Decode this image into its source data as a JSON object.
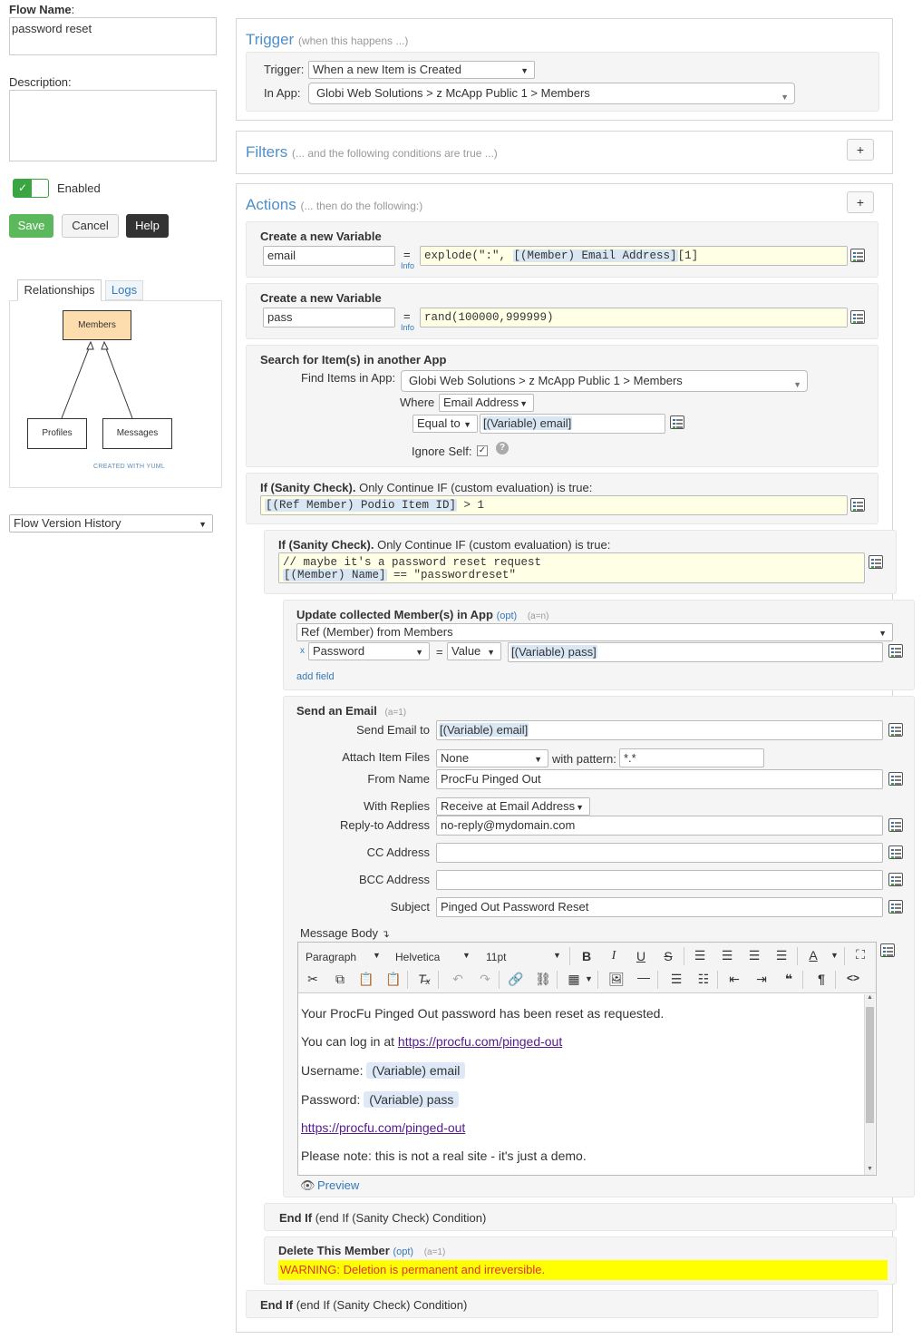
{
  "left": {
    "flow_name_label": "Flow Name",
    "flow_name_colon": ":",
    "flow_name_value": "password reset",
    "description_label": "Description:",
    "description_value": "",
    "enabled_label": "Enabled",
    "buttons": {
      "save": "Save",
      "cancel": "Cancel",
      "help": "Help"
    },
    "tabs": {
      "relationships": "Relationships",
      "logs": "Logs"
    },
    "diagram": {
      "nodes": [
        "Members",
        "Profiles",
        "Messages"
      ],
      "credit": "CREATED WITH YUML"
    },
    "history_select": "Flow Version History"
  },
  "trigger": {
    "title": "Trigger",
    "subtitle": "(when this happens ...)",
    "trigger_label": "Trigger:",
    "trigger_value": "When a new Item is Created",
    "app_label": "In App:",
    "app_value": "Globi Web Solutions > z McApp Public 1 > Members"
  },
  "filters": {
    "title": "Filters",
    "subtitle": "(... and the following conditions are true ...)",
    "add": "+"
  },
  "actions": {
    "title": "Actions",
    "subtitle": "(... then do the following:)",
    "add": "+",
    "var1": {
      "title": "Create a new Variable",
      "name": "email",
      "eq": "=",
      "info": "Info",
      "expr_a": "explode(\":\", ",
      "expr_tok": "[(Member) Email Address]",
      "expr_b": "[1]"
    },
    "var2": {
      "title": "Create a new Variable",
      "name": "pass",
      "eq": "=",
      "info": "Info",
      "expr": "rand(100000,999999)"
    },
    "search": {
      "title": "Search for Item(s) in another App",
      "find_label": "Find Items in App:",
      "find_value": "Globi Web Solutions > z McApp Public 1 > Members",
      "where_label": "Where",
      "where_value": "Email Address",
      "op_value": "Equal to",
      "match_value": "[(Variable) email]",
      "ignore_label": "Ignore Self:",
      "help": "?"
    },
    "if1": {
      "title": "If (Sanity Check).",
      "desc": " Only Continue IF (custom evaluation) is true:",
      "expr_tok": "[(Ref Member) Podio Item ID]",
      "expr_b": " > 1"
    },
    "if2": {
      "title": "If (Sanity Check).",
      "desc": " Only Continue IF (custom evaluation) is true:",
      "line1": "// maybe it's a password reset request",
      "line2_tok": "[(Member) Name]",
      "line2_b": " == \"passwordreset\""
    },
    "update": {
      "title": "Update collected Member(s) in App",
      "opt": "(opt)",
      "count": "(a=n)",
      "ref_value": "Ref (Member) from Members",
      "x": "x",
      "field_value": "Password",
      "eq": "=",
      "type_value": "Value",
      "value": "[(Variable) pass]",
      "add_field": "add field"
    },
    "email": {
      "title": "Send an Email",
      "count": "(a=1)",
      "to_label": "Send Email to",
      "to_value": "[(Variable) email]",
      "attach_label": "Attach Item Files",
      "attach_value": "None",
      "pattern_label": "with pattern:",
      "pattern_value": "*.*",
      "from_label": "From Name",
      "from_value": "ProcFu Pinged Out",
      "replies_label": "With Replies",
      "replies_value": "Receive at Email Address",
      "replyto_label": "Reply-to Address",
      "replyto_value": "no-reply@mydomain.com",
      "cc_label": "CC Address",
      "bcc_label": "BCC Address",
      "subject_label": "Subject",
      "subject_value": "Pinged Out Password Reset",
      "body_label": "Message Body",
      "toolbar": {
        "format": "Paragraph",
        "font": "Helvetica",
        "size": "11pt"
      },
      "body": {
        "p1": "Your ProcFu Pinged Out password has been reset as requested.",
        "p2_a": "You can log in at ",
        "link": "https://procfu.com/pinged-out",
        "user_label": "Username: ",
        "user_chip": "(Variable) email",
        "pass_label": "Password: ",
        "pass_chip": "(Variable) pass",
        "p5": "https://procfu.com/pinged-out",
        "p6": "Please note: this is not a real site - it's just a demo."
      },
      "preview": "Preview"
    },
    "endif_inner": {
      "title": "End If",
      "desc": " (end If (Sanity Check) Condition)"
    },
    "delete": {
      "title": "Delete This Member",
      "opt": "(opt)",
      "count": "(a=1)",
      "warning": "WARNING: Deletion is permanent and irreversible."
    },
    "endif_outer": {
      "title": "End If",
      "desc": " (end If (Sanity Check) Condition)"
    }
  }
}
